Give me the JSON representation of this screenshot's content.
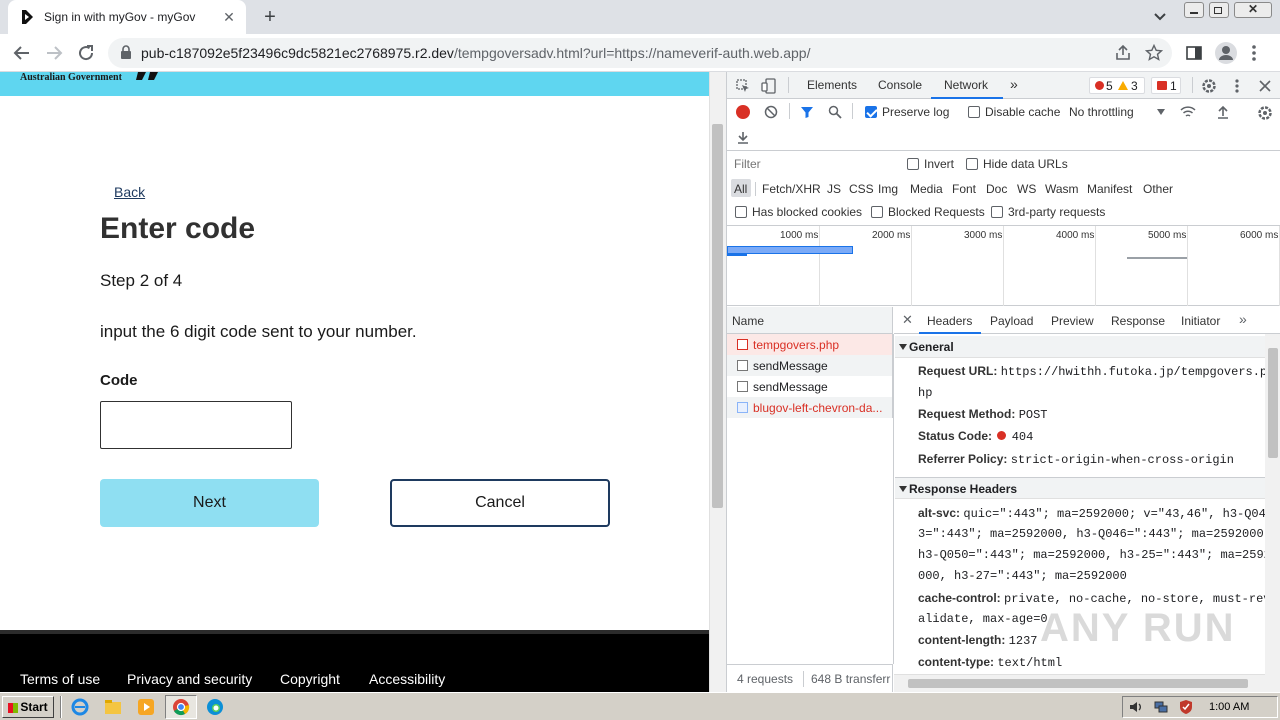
{
  "browser": {
    "tab_title": "Sign in with myGov - myGov",
    "url_host": "pub-c187092e5f23496c9dc5821ec2768975.r2.dev",
    "url_path": "/tempgoversadv.html?url=https://nameverif-auth.web.app/"
  },
  "page": {
    "gov_text": "Australian Government",
    "back_link": "Back",
    "heading": "Enter code",
    "step": "Step 2 of 4",
    "instruction": "input the 6 digit code sent to your number.",
    "code_label": "Code",
    "code_value": "",
    "next_label": "Next",
    "cancel_label": "Cancel",
    "footer_links": [
      "Terms of use",
      "Privacy and security",
      "Copyright",
      "Accessibility"
    ],
    "colors": {
      "gov_bar": "#5fd6f0",
      "next_button": "#8fdff2",
      "footer": "#000000"
    }
  },
  "devtools": {
    "tabs": [
      "Elements",
      "Console",
      "Network"
    ],
    "active_tab": "Network",
    "errors": "5",
    "warnings": "3",
    "issues": "1",
    "preserve_log": "Preserve log",
    "disable_cache": "Disable cache",
    "throttling": "No throttling",
    "filter_placeholder": "Filter",
    "invert": "Invert",
    "hide_data_urls": "Hide data URLs",
    "filter_types": [
      "All",
      "Fetch/XHR",
      "JS",
      "CSS",
      "Img",
      "Media",
      "Font",
      "Doc",
      "WS",
      "Wasm",
      "Manifest",
      "Other"
    ],
    "has_blocked_cookies": "Has blocked cookies",
    "blocked_requests": "Blocked Requests",
    "third_party": "3rd-party requests",
    "timeline_ticks": [
      "1000 ms",
      "2000 ms",
      "3000 ms",
      "4000 ms",
      "5000 ms",
      "6000 ms"
    ],
    "name_header": "Name",
    "requests": [
      {
        "name": "tempgovers.php",
        "error": true
      },
      {
        "name": "sendMessage",
        "error": false
      },
      {
        "name": "sendMessage",
        "error": false
      },
      {
        "name": "blugov-left-chevron-da...",
        "error": true
      }
    ],
    "footer_requests": "4 requests",
    "footer_transfer": "648 B transferr",
    "detail_tabs": [
      "Headers",
      "Payload",
      "Preview",
      "Response",
      "Initiator"
    ],
    "general_title": "General",
    "request_url_key": "Request URL:",
    "request_url_val1": "https://hwithh.futoka.jp/tempgovers.p",
    "request_url_val2": "hp",
    "request_method_key": "Request Method:",
    "request_method_val": "POST",
    "status_code_key": "Status Code:",
    "status_code_val": "404",
    "referrer_key": "Referrer Policy:",
    "referrer_val": "strict-origin-when-cross-origin",
    "response_headers_title": "Response Headers",
    "alt_svc_key": "alt-svc:",
    "alt_svc_l1": "quic=\":443\"; ma=2592000; v=\"43,46\", h3-Q04",
    "alt_svc_l2": "3=\":443\"; ma=2592000, h3-Q046=\":443\"; ma=2592000,",
    "alt_svc_l3": "h3-Q050=\":443\"; ma=2592000, h3-25=\":443\"; ma=2592",
    "alt_svc_l4": "000, h3-27=\":443\"; ma=2592000",
    "cache_control_key": "cache-control:",
    "cache_control_l1": "private, no-cache, no-store, must-rev",
    "cache_control_l2": "alidate, max-age=0",
    "content_length_key": "content-length:",
    "content_length_val": "1237",
    "content_type_key": "content-type:",
    "content_type_val": "text/html"
  },
  "taskbar": {
    "start": "Start",
    "clock": "1:00 AM"
  },
  "watermark": "ANY RUN"
}
